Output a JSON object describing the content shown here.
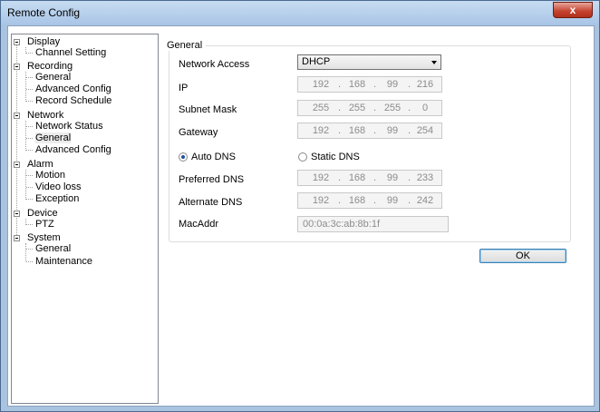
{
  "window": {
    "title": "Remote Config",
    "close_label": "x"
  },
  "tree": {
    "nodes": [
      {
        "label": "Display",
        "level": 0
      },
      {
        "label": "Channel Setting",
        "level": 1
      },
      {
        "label": "Recording",
        "level": 0
      },
      {
        "label": "General",
        "level": 1
      },
      {
        "label": "Advanced Config",
        "level": 1
      },
      {
        "label": "Record Schedule",
        "level": 1
      },
      {
        "label": "Network",
        "level": 0
      },
      {
        "label": "Network Status",
        "level": 1
      },
      {
        "label": "General",
        "level": 1,
        "selected": true
      },
      {
        "label": "Advanced Config",
        "level": 1
      },
      {
        "label": "Alarm",
        "level": 0
      },
      {
        "label": "Motion",
        "level": 1
      },
      {
        "label": "Video loss",
        "level": 1
      },
      {
        "label": "Exception",
        "level": 1
      },
      {
        "label": "Device",
        "level": 0
      },
      {
        "label": "PTZ",
        "level": 1
      },
      {
        "label": "System",
        "level": 0
      },
      {
        "label": "General",
        "level": 1
      },
      {
        "label": "Maintenance",
        "level": 1
      }
    ]
  },
  "form": {
    "group_title": "General",
    "network_access_label": "Network Access",
    "network_access_value": "DHCP",
    "ip_label": "IP",
    "ip": [
      "192",
      "168",
      "99",
      "216"
    ],
    "subnet_label": "Subnet Mask",
    "subnet": [
      "255",
      "255",
      "255",
      "0"
    ],
    "gateway_label": "Gateway",
    "gateway": [
      "192",
      "168",
      "99",
      "254"
    ],
    "auto_dns_label": "Auto DNS",
    "static_dns_label": "Static DNS",
    "dns_mode": "auto",
    "preferred_dns_label": "Preferred DNS",
    "preferred_dns": [
      "192",
      "168",
      "99",
      "233"
    ],
    "alternate_dns_label": "Alternate DNS",
    "alternate_dns": [
      "192",
      "168",
      "99",
      "242"
    ],
    "mac_label": "MacAddr",
    "mac_value": "00:0a:3c:ab:8b:1f",
    "ok_label": "OK"
  }
}
